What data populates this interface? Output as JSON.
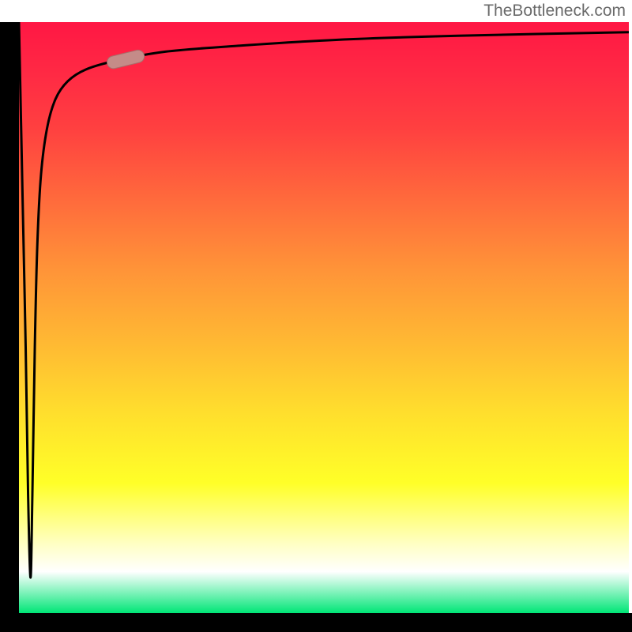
{
  "watermark": "TheBottleneck.com",
  "chart_data": {
    "type": "line",
    "title": "",
    "xlabel": "",
    "ylabel": "",
    "x_range": [
      0,
      100
    ],
    "y_range": [
      0,
      100
    ],
    "background_gradient": {
      "top": "#ff1744",
      "mid": "#ffde2d",
      "bottom": "#00e676",
      "meaning": "red=bad, green=good"
    },
    "curve": {
      "description": "bottleneck curve with brief downward spike near x=0 then asymptotic rise toward top",
      "points": [
        {
          "x": 0.0,
          "y": 100.0
        },
        {
          "x": 0.6,
          "y": 70.0
        },
        {
          "x": 1.1,
          "y": 45.0
        },
        {
          "x": 1.5,
          "y": 20.0
        },
        {
          "x": 1.9,
          "y": 6.0
        },
        {
          "x": 2.2,
          "y": 20.0
        },
        {
          "x": 2.6,
          "y": 45.0
        },
        {
          "x": 3.0,
          "y": 62.0
        },
        {
          "x": 3.6,
          "y": 74.0
        },
        {
          "x": 4.6,
          "y": 82.0
        },
        {
          "x": 6.0,
          "y": 87.0
        },
        {
          "x": 8.0,
          "y": 90.0
        },
        {
          "x": 11.0,
          "y": 92.0
        },
        {
          "x": 16.0,
          "y": 93.5
        },
        {
          "x": 24.0,
          "y": 95.0
        },
        {
          "x": 36.0,
          "y": 96.0
        },
        {
          "x": 52.0,
          "y": 97.0
        },
        {
          "x": 72.0,
          "y": 97.7
        },
        {
          "x": 100.0,
          "y": 98.3
        }
      ]
    },
    "marker": {
      "x": 17.5,
      "y": 93.7,
      "color": "#c58b88"
    }
  }
}
